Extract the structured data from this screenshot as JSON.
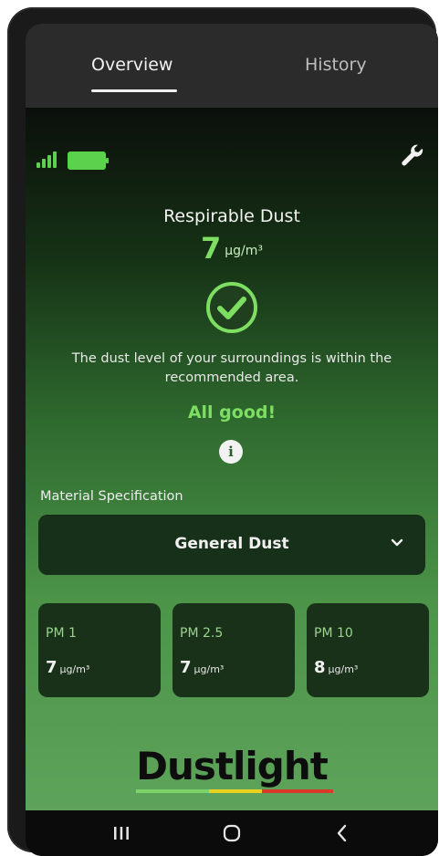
{
  "tabs": [
    {
      "label": "Overview",
      "active": true
    },
    {
      "label": "History",
      "active": false
    }
  ],
  "status": {
    "signal_icon": "signal-bars-icon",
    "battery_icon": "battery-full-icon",
    "settings_icon": "wrench-icon",
    "accent": "#5bd14d"
  },
  "reading": {
    "title": "Respirable Dust",
    "value": "7",
    "unit": "µg/m³",
    "status_icon": "check-circle-icon",
    "message": "The dust level of your surroundings is within the recommended area.",
    "status_text": "All good!",
    "info_icon": "info-icon",
    "info_glyph": "i",
    "status_color": "#7dde62"
  },
  "material": {
    "label": "Material Specification",
    "selected": "General Dust",
    "chevron_icon": "chevron-down-icon"
  },
  "pm": [
    {
      "label": "PM 1",
      "value": "7",
      "unit": "µg/m³"
    },
    {
      "label": "PM 2.5",
      "value": "7",
      "unit": "µg/m³"
    },
    {
      "label": "PM 10",
      "value": "8",
      "unit": "µg/m³"
    }
  ],
  "brand": {
    "name": "Dustlight",
    "stripe_colors": [
      "#7dd36a",
      "#e9d21f",
      "#d83a2b"
    ]
  },
  "nav": [
    {
      "icon": "recent-apps-icon"
    },
    {
      "icon": "home-icon"
    },
    {
      "icon": "back-icon"
    }
  ]
}
